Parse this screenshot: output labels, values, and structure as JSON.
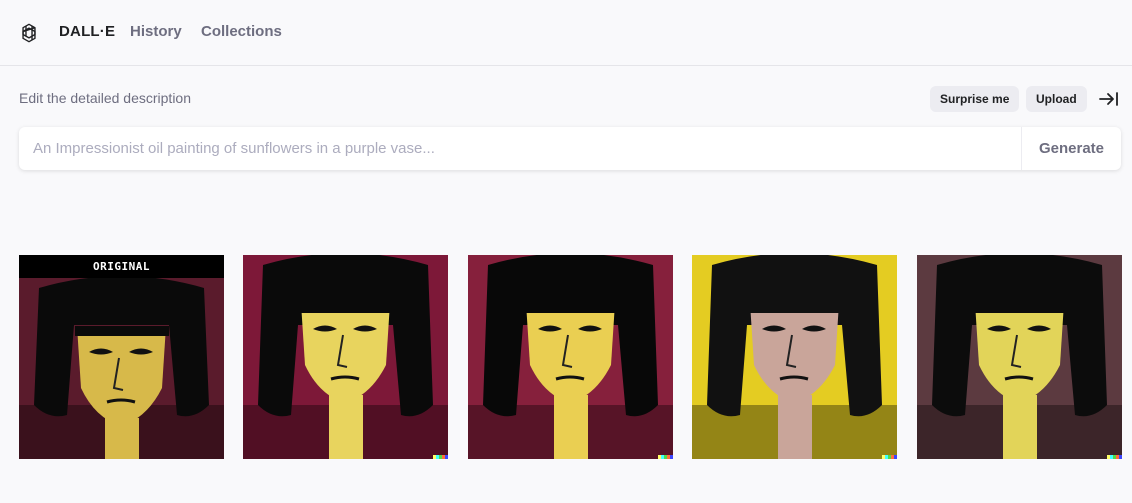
{
  "header": {
    "brand": "DALL·E",
    "nav": {
      "history": "History",
      "collections": "Collections"
    },
    "logo_icon": "openai-logo-icon"
  },
  "editor": {
    "label": "Edit the detailed description",
    "surprise_label": "Surprise me",
    "upload_label": "Upload",
    "collapse_icon": "arrow-right-to-bar-icon",
    "prompt": {
      "value": "",
      "placeholder": "An Impressionist oil painting of sunflowers in a purple vase..."
    },
    "generate_label": "Generate"
  },
  "gallery": {
    "original_badge": "ORIGINAL",
    "images": [
      {
        "bg": "#5a1b2c",
        "face": "#d7b94a",
        "hair": "#0a0a0a",
        "is_original": true
      },
      {
        "bg": "#7d1838",
        "face": "#e8d45e",
        "hair": "#0a0a0a",
        "is_original": false
      },
      {
        "bg": "#86203c",
        "face": "#eacf52",
        "hair": "#080808",
        "is_original": false
      },
      {
        "bg": "#e4cc22",
        "face": "#c9a59a",
        "hair": "#111111",
        "is_original": false
      },
      {
        "bg": "#5c3a40",
        "face": "#e2d459",
        "hair": "#0c0c0c",
        "is_original": false
      }
    ]
  },
  "colors": {
    "accent": "#202123",
    "muted": "#6e6e80",
    "chip_bg": "#ececf1",
    "page_bg": "#f9f9fb"
  }
}
